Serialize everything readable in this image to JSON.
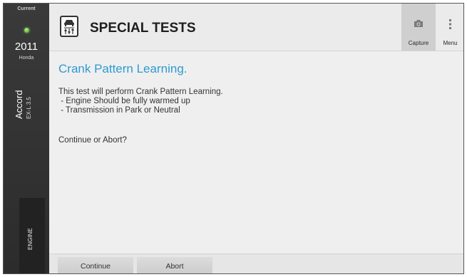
{
  "sidebar": {
    "status_label": "Current",
    "year": "2011",
    "make": "Honda",
    "model": "Accord",
    "trim": "EX-L 3.5",
    "system": "ENGINE",
    "status_led_color": "#5ec72e"
  },
  "header": {
    "title": "SPECIAL TESTS",
    "app_icon": "car-gauge-icon",
    "capture_label": "Capture",
    "capture_icon": "camera-icon",
    "menu_label": "Menu",
    "menu_icon": "vertical-dots-icon"
  },
  "content": {
    "heading": "Crank Pattern Learning.",
    "heading_color": "#2e9bd1",
    "lines": [
      "This test will perform Crank Pattern Learning.",
      " - Engine Should be fully warmed up",
      " - Transmission in Park or Neutral"
    ],
    "question": "Continue or Abort?"
  },
  "footer": {
    "continue_label": "Continue",
    "abort_label": "Abort"
  }
}
